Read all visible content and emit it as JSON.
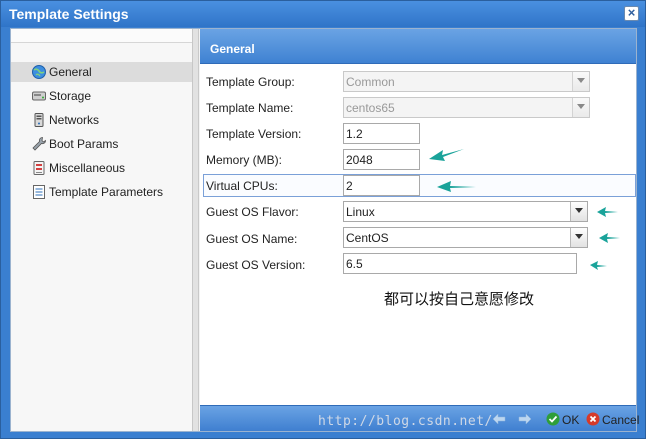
{
  "window": {
    "title": "Template Settings",
    "close_symbol": "×"
  },
  "nav": {
    "items": [
      {
        "label": "General",
        "icon": "globe-icon",
        "selected": true
      },
      {
        "label": "Storage",
        "icon": "disk-icon"
      },
      {
        "label": "Networks",
        "icon": "network-icon"
      },
      {
        "label": "Boot Params",
        "icon": "wrench-icon"
      },
      {
        "label": "Miscellaneous",
        "icon": "misc-icon"
      },
      {
        "label": "Template Parameters",
        "icon": "list-icon"
      }
    ]
  },
  "panel": {
    "title": "General"
  },
  "form": {
    "template_group": {
      "label": "Template Group:",
      "value": "Common"
    },
    "template_name": {
      "label": "Template Name:",
      "value": "centos65"
    },
    "template_version": {
      "label": "Template Version:",
      "value": "1.2"
    },
    "memory": {
      "label": "Memory (MB):",
      "value": "2048"
    },
    "vcpus": {
      "label": "Virtual CPUs:",
      "value": "2"
    },
    "os_flavor": {
      "label": "Guest OS Flavor:",
      "value": "Linux"
    },
    "os_name": {
      "label": "Guest OS Name:",
      "value": "CentOS"
    },
    "os_version": {
      "label": "Guest OS Version:",
      "value": "6.5"
    }
  },
  "annotation": {
    "note": "都可以按自己意愿修改",
    "arrow_color": "#1aa39a"
  },
  "footer": {
    "watermark": "http://blog.csdn.net/",
    "ok_label": "OK",
    "cancel_label": "Cancel"
  },
  "colors": {
    "header_blue": "#3f82d2",
    "accent_teal": "#1aa39a"
  }
}
